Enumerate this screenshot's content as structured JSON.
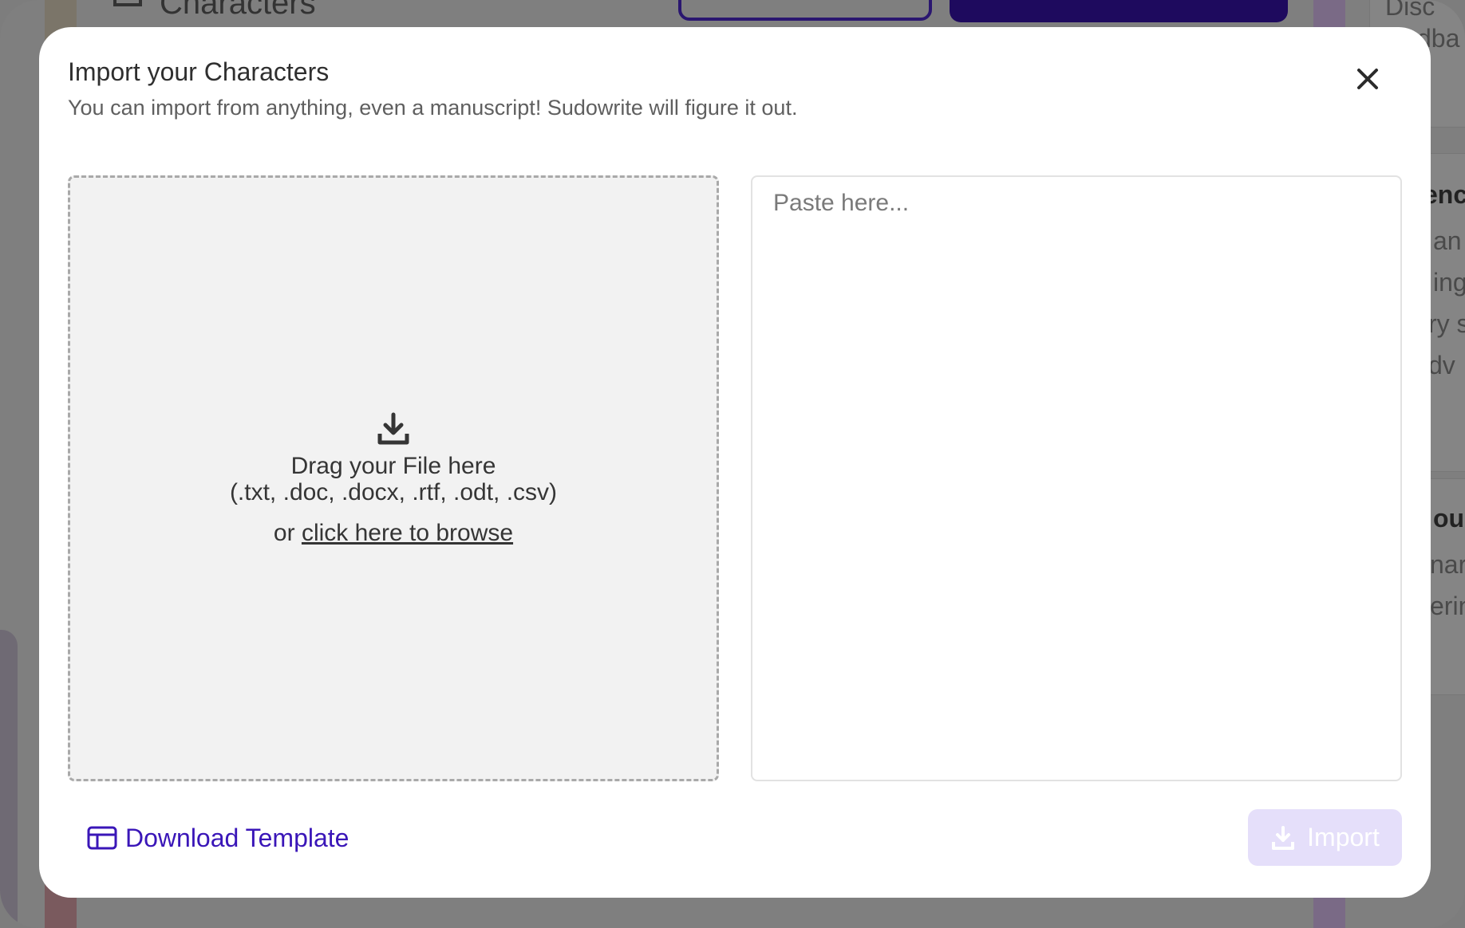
{
  "background": {
    "topbar_title": "Characters",
    "sidebar_fragments": [
      "Disc",
      "dba",
      "enc",
      "an",
      "ing",
      "ry s",
      "dv",
      "ou",
      "nar",
      "erin"
    ]
  },
  "modal": {
    "title": "Import your Characters",
    "subtitle": "You can import from anything, even a manuscript! Sudowrite will figure it out.",
    "close_icon": "close-icon",
    "dropzone": {
      "icon": "download-icon",
      "line1": "Drag your File here",
      "line2": "(.txt, .doc, .docx, .rtf, .odt, .csv)",
      "or_text": "or",
      "browse_link": "click here to browse"
    },
    "paste": {
      "placeholder": "Paste here..."
    },
    "download_template": {
      "icon": "table-icon",
      "label": "Download Template"
    },
    "import_button": {
      "icon": "download-icon",
      "label": "Import",
      "disabled": true
    }
  },
  "colors": {
    "accent": "#3a16b8",
    "import_disabled_bg": "#e5dffa",
    "dropzone_bg": "#f2f2f2",
    "overlay": "#7f7f7f"
  }
}
